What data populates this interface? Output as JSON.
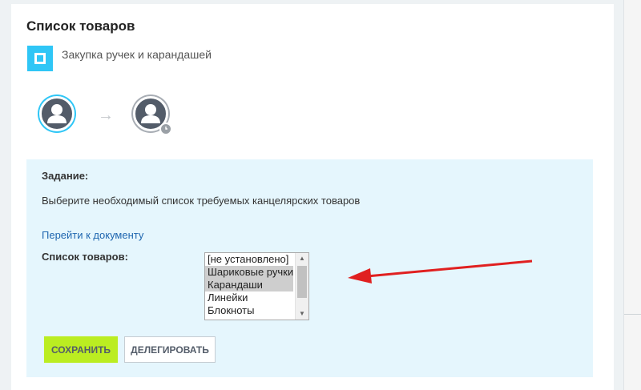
{
  "page": {
    "title": "Список товаров",
    "process_name": "Закупка ручек и карандашей"
  },
  "workflow": {
    "arrow_glyph": "→"
  },
  "task": {
    "heading": "Задание:",
    "description": "Выберите необходимый список требуемых канцелярских товаров",
    "document_link": "Перейти к документу",
    "field_label": "Список товаров:",
    "options": [
      {
        "label": "[не установлено]",
        "selected": false
      },
      {
        "label": "Шариковые ручки",
        "selected": true
      },
      {
        "label": "Карандаши",
        "selected": true
      },
      {
        "label": "Линейки",
        "selected": false
      },
      {
        "label": "Блокноты",
        "selected": false
      }
    ]
  },
  "buttons": {
    "save": "СОХРАНИТЬ",
    "delegate": "ДЕЛЕГИРОВАТЬ"
  },
  "colors": {
    "accent": "#2fc6f6",
    "task_background": "#e5f6fd",
    "save_button": "#bbed21",
    "annotation_arrow": "#e02020",
    "link": "#2067b0"
  }
}
